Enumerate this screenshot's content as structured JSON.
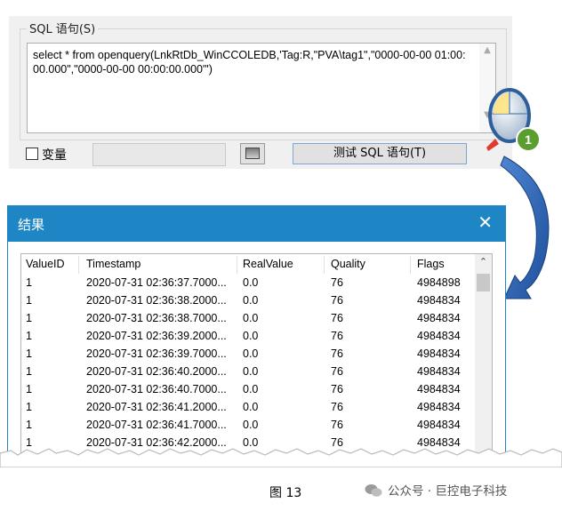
{
  "sql_panel": {
    "group_label": "SQL 语句(S)",
    "query_text": "select * from openquery(LnkRtDb_WinCCOLEDB,'Tag:R,\"PVA\\tag1\",\"0000-00-00 01:00:00.000\",\"0000-00-00 00:00:00.000\"')",
    "variable_label": "变量",
    "variable_checked": false,
    "variable_value": "",
    "test_button_label": "测试 SQL 语句(T)"
  },
  "annotation": {
    "step_badge": "1",
    "badge_color": "#5a9e2f",
    "arrow_color": "#2b67b8",
    "pointer_color": "#e23b2e"
  },
  "result_window": {
    "title": "结果",
    "close_icon": "close-icon",
    "columns": [
      "ValueID",
      "Timestamp",
      "RealValue",
      "Quality",
      "Flags"
    ],
    "rows": [
      [
        "1",
        "2020-07-31 02:36:37.7000...",
        "0.0",
        "76",
        "4984898"
      ],
      [
        "1",
        "2020-07-31 02:36:38.2000...",
        "0.0",
        "76",
        "4984834"
      ],
      [
        "1",
        "2020-07-31 02:36:38.7000...",
        "0.0",
        "76",
        "4984834"
      ],
      [
        "1",
        "2020-07-31 02:36:39.2000...",
        "0.0",
        "76",
        "4984834"
      ],
      [
        "1",
        "2020-07-31 02:36:39.7000...",
        "0.0",
        "76",
        "4984834"
      ],
      [
        "1",
        "2020-07-31 02:36:40.2000...",
        "0.0",
        "76",
        "4984834"
      ],
      [
        "1",
        "2020-07-31 02:36:40.7000...",
        "0.0",
        "76",
        "4984834"
      ],
      [
        "1",
        "2020-07-31 02:36:41.2000...",
        "0.0",
        "76",
        "4984834"
      ],
      [
        "1",
        "2020-07-31 02:36:41.7000...",
        "0.0",
        "76",
        "4984834"
      ],
      [
        "1",
        "2020-07-31 02:36:42.2000...",
        "0.0",
        "76",
        "4984834"
      ]
    ],
    "titlebar_color": "#1f86c6"
  },
  "caption": "图 13",
  "watermark": "公众号 · 巨控电子科技"
}
